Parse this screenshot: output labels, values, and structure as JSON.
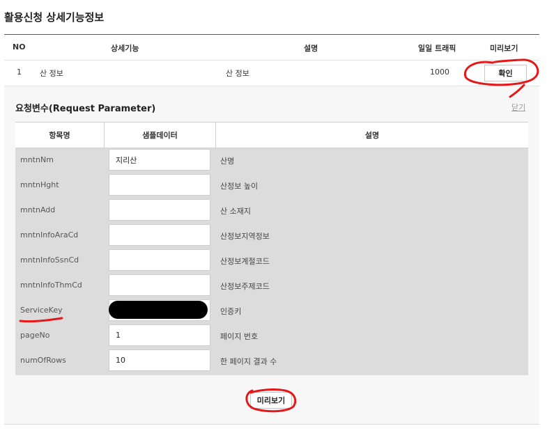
{
  "page": {
    "title": "활용신청 상세기능정보"
  },
  "table": {
    "headers": {
      "no": "NO",
      "feature": "상세기능",
      "desc": "설명",
      "traffic": "일일 트래픽",
      "preview": "미리보기"
    },
    "row": {
      "no": "1",
      "feature": "산 정보",
      "desc": "산 정보",
      "traffic": "1000",
      "confirm_label": "확인"
    }
  },
  "request": {
    "title": "요청변수(Request Parameter)",
    "close_label": "닫기",
    "headers": {
      "name": "항목명",
      "sample": "샘플데이터",
      "desc": "설명"
    },
    "params": [
      {
        "name": "mntnNm",
        "value": "지리산",
        "desc": "산명"
      },
      {
        "name": "mntnHght",
        "value": "",
        "desc": "산정보 높이"
      },
      {
        "name": "mntnAdd",
        "value": "",
        "desc": "산 소재지"
      },
      {
        "name": "mntnInfoAraCd",
        "value": "",
        "desc": "산정보지역정보"
      },
      {
        "name": "mntnInfoSsnCd",
        "value": "",
        "desc": "산정보계절코드"
      },
      {
        "name": "mntnInfoThmCd",
        "value": "",
        "desc": "산정보주제코드"
      },
      {
        "name": "ServiceKey",
        "value": "",
        "desc": "인증키"
      },
      {
        "name": "pageNo",
        "value": "1",
        "desc": "페이지 번호"
      },
      {
        "name": "numOfRows",
        "value": "10",
        "desc": "한 페이지 결과 수"
      }
    ],
    "preview_label": "미리보기"
  }
}
